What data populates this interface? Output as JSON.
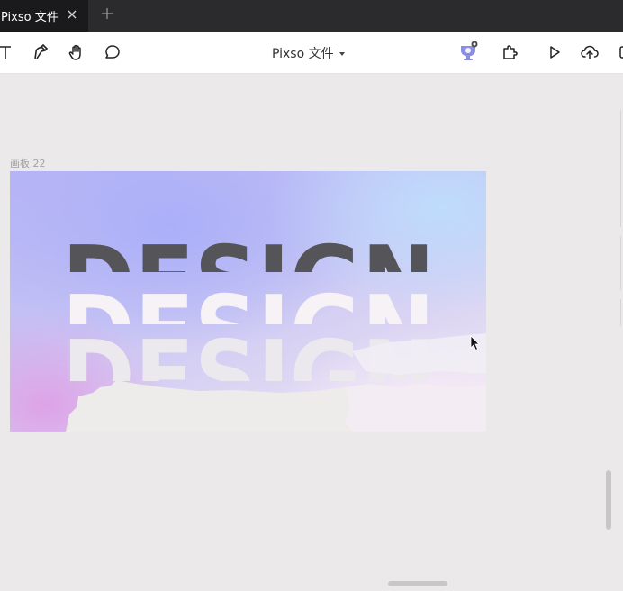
{
  "tab": {
    "title": "Pixso 文件",
    "close_icon": "close-icon",
    "add_icon": "plus-icon"
  },
  "toolbar": {
    "title": "Pixso 文件",
    "tools": [
      "text-icon",
      "pen-icon",
      "hand-icon",
      "comment-icon"
    ],
    "right_tools": [
      "avatar-badge-icon",
      "plugin-icon",
      "play-icon",
      "cloud-upload-icon"
    ]
  },
  "canvas": {
    "artboard_label": "画板 22",
    "artboard_text": "DESIGN"
  },
  "colors": {
    "tab_bg": "#1a1a1c",
    "tabbar_bg": "#2b2b2d",
    "canvas_bg": "#ebe9e9",
    "design_dark": "#555459",
    "design_light": "#f4f0f4"
  }
}
